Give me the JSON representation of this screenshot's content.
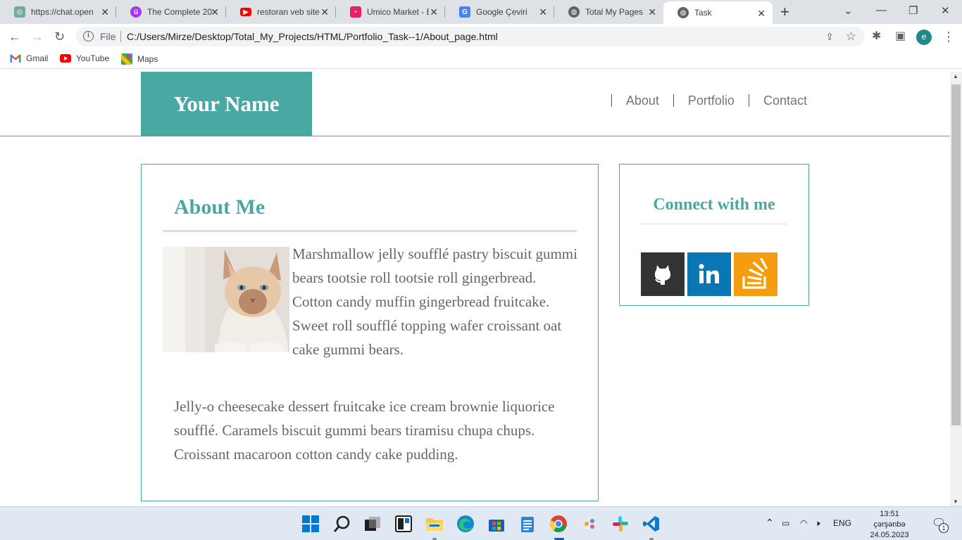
{
  "browser": {
    "tabs": [
      {
        "label": "https://chat.open",
        "icon": "openai-icon"
      },
      {
        "label": "The Complete 20",
        "icon": "udemy-icon"
      },
      {
        "label": "restoran veb site",
        "icon": "youtube-icon"
      },
      {
        "label": "Umico Market - E",
        "icon": "umico-icon"
      },
      {
        "label": "Google Çeviri",
        "icon": "google-translate-icon"
      },
      {
        "label": "Total My Pages",
        "icon": "globe-icon"
      },
      {
        "label": "Task",
        "icon": "globe-icon"
      }
    ],
    "active_tab": 6,
    "address_label": "File",
    "url": "C:/Users/Mirze/Desktop/Total_My_Projects/HTML/Portfolio_Task--1/About_page.html",
    "profile_initial": "e",
    "bookmarks": [
      {
        "label": "Gmail",
        "icon": "gmail-icon"
      },
      {
        "label": "YouTube",
        "icon": "youtube-icon"
      },
      {
        "label": "Maps",
        "icon": "maps-icon"
      }
    ]
  },
  "page": {
    "brand": "Your Name",
    "nav": [
      "About",
      "Portfolio",
      "Contact"
    ],
    "about": {
      "title": "About Me",
      "paragraph1": "Marshmallow jelly soufflé pastry biscuit gummi bears tootsie roll tootsie roll gingerbread. Cotton candy muffin gingerbread fruitcake. Sweet roll soufflé topping wafer croissant oat cake gummi bears.",
      "paragraph2": "Jelly-o cheesecake dessert fruitcake ice cream brownie liquorice soufflé. Caramels biscuit gummi bears tiramisu chupa chups. Croissant macaroon cotton candy cake pudding.",
      "image": "cat-photo"
    },
    "connect": {
      "title": "Connect with me",
      "links": [
        "github-icon",
        "linkedin-icon",
        "stackoverflow-icon"
      ]
    },
    "colors": {
      "accent": "#4aa8a3",
      "text": "#666666"
    }
  },
  "taskbar": {
    "language": "ENG",
    "time": "13:51",
    "day": "çərşənbə",
    "date": "24.05.2023",
    "notifications": "1"
  }
}
